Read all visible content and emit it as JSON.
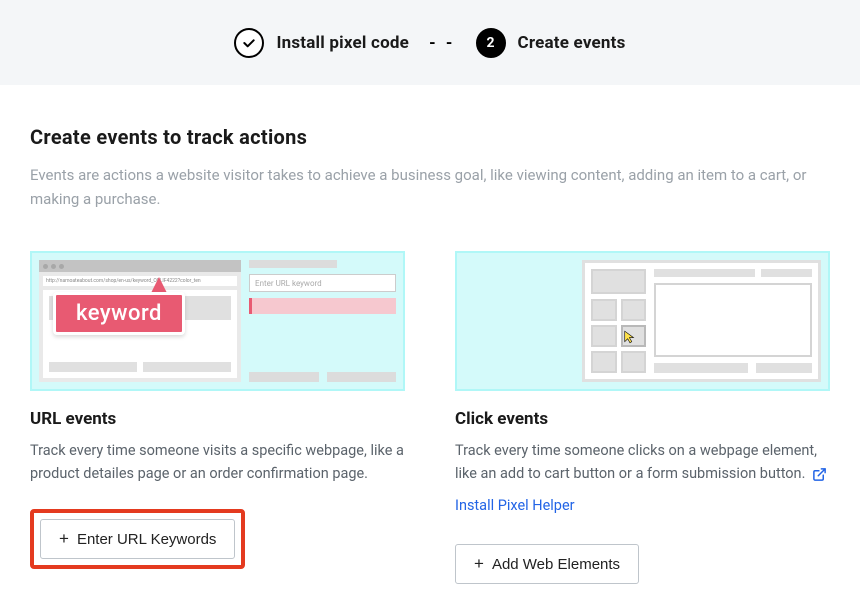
{
  "stepper": {
    "step1_label": "Install pixel code",
    "step2_number": "2",
    "step2_label": "Create events",
    "separator": "- -"
  },
  "section": {
    "title": "Create events to track actions",
    "description": "Events are actions a website visitor takes to achieve a business goal, like viewing content, adding an item to a cart, or making a purchase."
  },
  "url_card": {
    "title": "URL events",
    "description": "Track every time someone visits a specific webpage, like a product detailes page or an order confirmation page.",
    "button_label": "Enter URL Keywords",
    "illus_url_text": "http://namoateabout.com/shop/en-us/keyword_OELIF4222?color_ten",
    "illus_input_placeholder": "Enter URL keyword",
    "illus_keyword_tag": "keyword"
  },
  "click_card": {
    "title": "Click events",
    "description": "Track every time someone clicks on a webpage element, like an add to cart button or a form submission button.",
    "helper_link_label": "Install Pixel Helper",
    "button_label": "Add Web Elements"
  }
}
